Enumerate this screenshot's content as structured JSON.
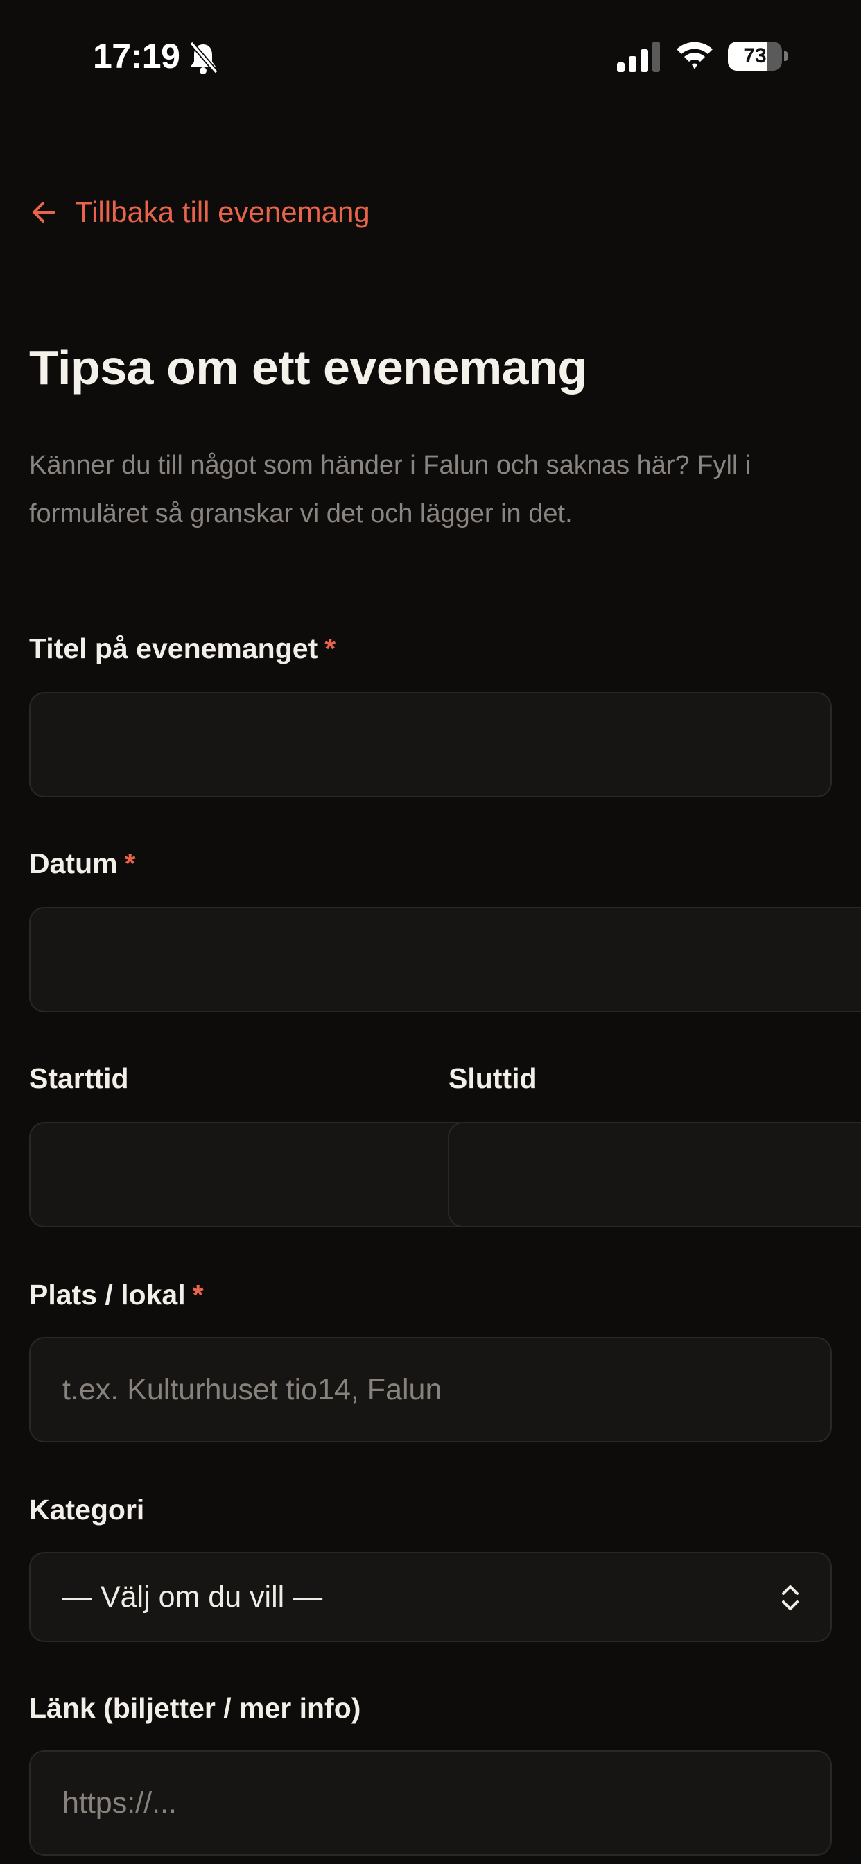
{
  "status_bar": {
    "time": "17:19",
    "battery": "73",
    "battery_level": 0.73
  },
  "back_link": {
    "label": "Tillbaka till evenemang"
  },
  "page": {
    "title": "Tipsa om ett evenemang",
    "intro": "Känner du till något som händer i Falun och saknas här? Fyll i formuläret så granskar vi det och lägger in det."
  },
  "form": {
    "required_mark": "*",
    "title_field": {
      "label": "Titel på evenemanget",
      "value": ""
    },
    "date_field": {
      "label": "Datum",
      "value": ""
    },
    "start_time": {
      "label": "Starttid",
      "value": ""
    },
    "end_time": {
      "label": "Sluttid",
      "value": ""
    },
    "location": {
      "label": "Plats / lokal",
      "placeholder": "t.ex. Kulturhuset tio14, Falun"
    },
    "category": {
      "label": "Kategori",
      "selected": "— Välj om du vill —"
    },
    "link": {
      "label": "Länk (biljetter / mer info)",
      "placeholder": "https://..."
    }
  },
  "colors": {
    "accent": "#e8644a",
    "background": "#0d0c0b",
    "field_bg": "#161513"
  },
  "icons": {
    "back": "arrow-left-icon",
    "bell": "bell-slash-icon",
    "signal": "signal-icon",
    "wifi": "wifi-icon",
    "battery": "battery-icon",
    "chevron": "chevron-up-down-icon"
  }
}
